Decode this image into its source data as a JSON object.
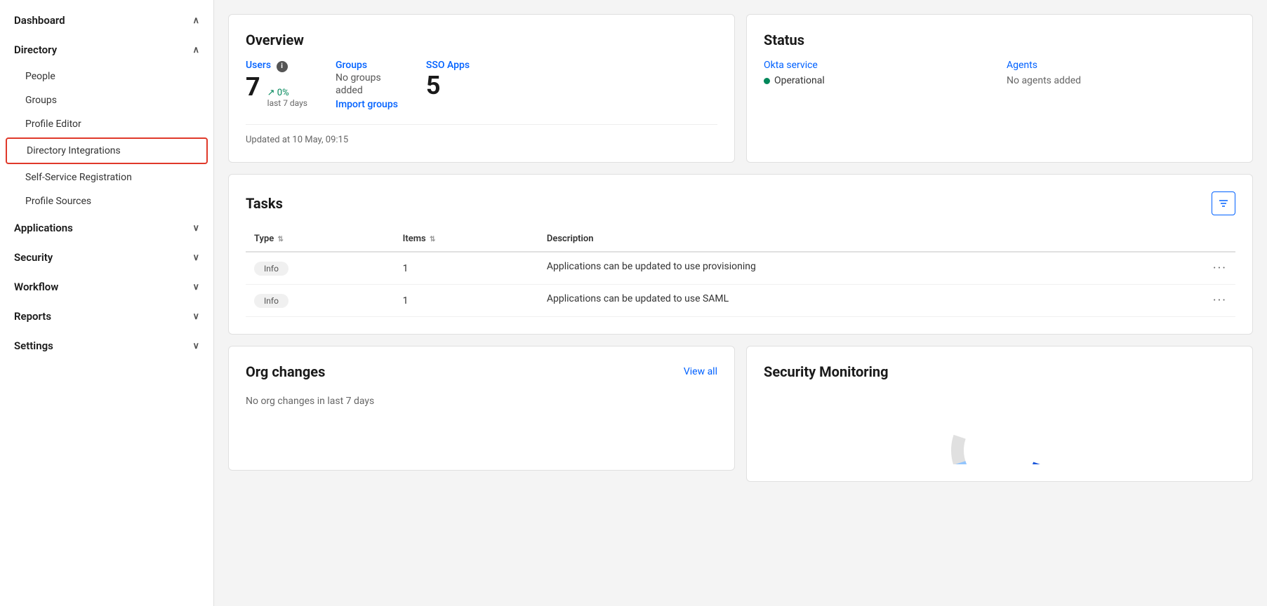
{
  "sidebar": {
    "items": [
      {
        "id": "dashboard",
        "label": "Dashboard",
        "expanded": true,
        "chevron": "∧"
      },
      {
        "id": "directory",
        "label": "Directory",
        "expanded": true,
        "chevron": "∧"
      },
      {
        "id": "applications",
        "label": "Applications",
        "expanded": false,
        "chevron": "∨"
      },
      {
        "id": "security",
        "label": "Security",
        "expanded": false,
        "chevron": "∨"
      },
      {
        "id": "workflow",
        "label": "Workflow",
        "expanded": false,
        "chevron": "∨"
      },
      {
        "id": "reports",
        "label": "Reports",
        "expanded": false,
        "chevron": "∨"
      },
      {
        "id": "settings",
        "label": "Settings",
        "expanded": false,
        "chevron": "∨"
      }
    ],
    "directory_sub": [
      {
        "id": "people",
        "label": "People"
      },
      {
        "id": "groups",
        "label": "Groups"
      },
      {
        "id": "profile-editor",
        "label": "Profile Editor"
      },
      {
        "id": "directory-integrations",
        "label": "Directory Integrations",
        "active": true
      },
      {
        "id": "self-service-registration",
        "label": "Self-Service Registration"
      },
      {
        "id": "profile-sources",
        "label": "Profile Sources"
      }
    ]
  },
  "overview": {
    "title": "Overview",
    "users_label": "Users",
    "users_count": "7",
    "users_trend": "↗ 0%",
    "users_trend_sub": "last 7 days",
    "groups_label": "Groups",
    "groups_text1": "No groups",
    "groups_text2": "added",
    "groups_import": "Import groups",
    "sso_label": "SSO Apps",
    "sso_count": "5",
    "updated_text": "Updated at 10 May, 09:15"
  },
  "status": {
    "title": "Status",
    "okta_service_label": "Okta service",
    "okta_status": "Operational",
    "agents_label": "Agents",
    "agents_status": "No agents added"
  },
  "tasks": {
    "title": "Tasks",
    "columns": [
      "Type",
      "Items",
      "Description"
    ],
    "rows": [
      {
        "type": "Info",
        "items": "1",
        "description": "Applications can be updated to use provisioning"
      },
      {
        "type": "Info",
        "items": "1",
        "description": "Applications can be updated to use SAML"
      }
    ]
  },
  "org_changes": {
    "title": "Org changes",
    "view_all_label": "View all",
    "empty_message": "No org changes in last 7 days"
  },
  "security_monitoring": {
    "title": "Security Monitoring"
  }
}
